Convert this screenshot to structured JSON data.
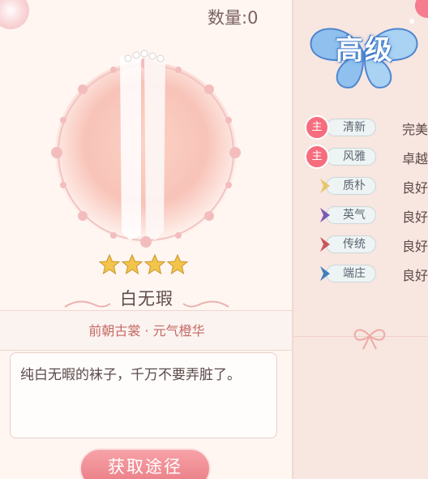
{
  "item": {
    "count_label": "数量:0",
    "name": "白无瑕",
    "stars": 4,
    "source": "前朝古裳 · 元气橙华",
    "description": "纯白无暇的袜子，千万不要弄脏了。",
    "get_button": "获取途径"
  },
  "grade": {
    "label": "高级"
  },
  "attributes": [
    {
      "name": "清新",
      "value": "完美",
      "main": true,
      "main_label": "主",
      "chevron_color": "#f56d7e"
    },
    {
      "name": "风雅",
      "value": "卓越",
      "main": true,
      "main_label": "主",
      "chevron_color": "#f56d7e"
    },
    {
      "name": "质朴",
      "value": "良好",
      "main": false,
      "chevron_color": "#e8c56a"
    },
    {
      "name": "英气",
      "value": "良好",
      "main": false,
      "chevron_color": "#7a5ab3"
    },
    {
      "name": "传统",
      "value": "良好",
      "main": false,
      "chevron_color": "#c9555c"
    },
    {
      "name": "端庄",
      "value": "良好",
      "main": false,
      "chevron_color": "#3f7fbf"
    }
  ],
  "colors": {
    "accent": "#ea7a83",
    "panel": "#fff6f2",
    "text": "#5a4a4a"
  }
}
